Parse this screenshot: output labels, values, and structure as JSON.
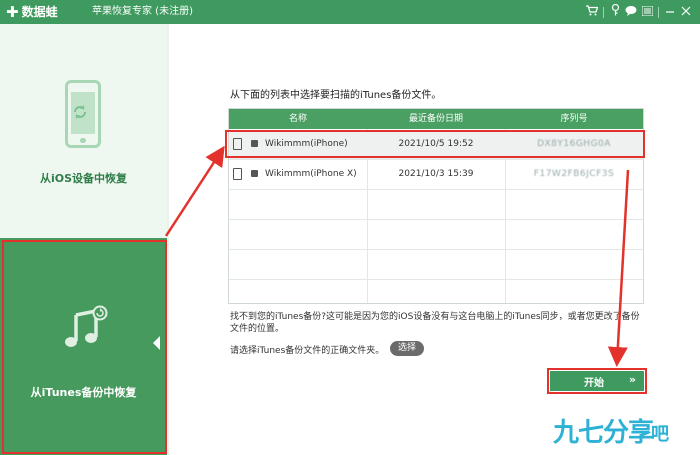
{
  "app": {
    "logo_mark": "✚",
    "logo_name": "数据蛙",
    "title": "苹果恢复专家 (未注册)"
  },
  "titlebar_icons": [
    "cart-icon",
    "key-icon",
    "chat-icon",
    "menu-icon",
    "minimize-icon",
    "close-icon"
  ],
  "sidebar": {
    "items": [
      {
        "label": "从iOS设备中恢复",
        "icon": "phone-refresh-icon",
        "active": false
      },
      {
        "label": "从iTunes备份中恢复",
        "icon": "music-note-icon",
        "active": true
      }
    ]
  },
  "main": {
    "instruction": "从下面的列表中选择要扫描的iTunes备份文件。",
    "table": {
      "columns": [
        "名称",
        "最近备份日期",
        "序列号"
      ],
      "rows": [
        {
          "name": "Wikimmm(iPhone)",
          "date": "2021/10/5 19:52",
          "serial": "DX8Y16GHG0A",
          "selected": true
        },
        {
          "name": "Wikimmm(iPhone X)",
          "date": "2021/10/3 15:39",
          "serial": "F17W2FB6JCF3S",
          "selected": false
        }
      ]
    },
    "help_text": "找不到您的iTunes备份?这可能是因为您的iOS设备没有与这台电脑上的iTunes同步，或者您更改了备份文件的位置。",
    "select_prompt": "请选择iTunes备份文件的正确文件夹。",
    "select_button": "选择",
    "start_button": "开始",
    "start_arrow": "»"
  },
  "watermark": {
    "text": "九七分享",
    "suffix": "吧"
  },
  "colors": {
    "brand_green": "#3f9a5f",
    "highlight_red": "#e3322b",
    "watermark_blue": "#2db2d6"
  }
}
